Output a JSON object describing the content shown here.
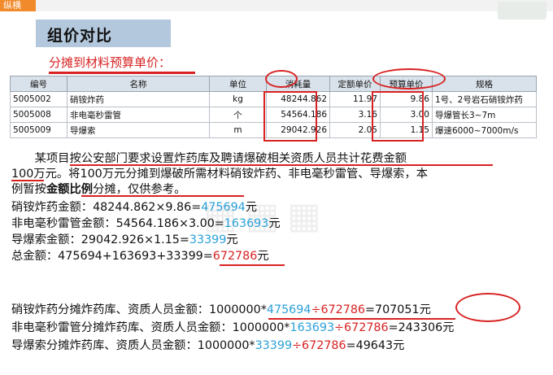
{
  "brand": {
    "label": "纵横"
  },
  "title": "组价对比",
  "subtitle": "分摊到材料预算单价：",
  "table": {
    "headers": [
      "编号",
      "名称",
      "单位",
      "消耗量",
      "定额单价",
      "预算单价",
      "规格"
    ],
    "rows": [
      [
        "5005002",
        "硝铵炸药",
        "kg",
        "48244.862",
        "11.97",
        "9.86",
        "1号、2号岩石硝铵炸药"
      ],
      [
        "5005008",
        "非电毫秒雷管",
        "个",
        "54564.186",
        "3.16",
        "3.00",
        "导爆管长3~7m"
      ],
      [
        "5005009",
        "导爆索",
        "m",
        "29042.926",
        "2.05",
        "1.15",
        "爆速6000~7000m/s"
      ]
    ]
  },
  "paragraph": {
    "line1": "某项目按公安部门要求设置炸药库及聘请爆破相关资质人员共计花费金额",
    "line2": "100万元。将100万元分摊到爆破所需材料硝铵炸药、非电毫秒雷管、导爆索，本",
    "line3_a": "例暂按",
    "line3_b": "金额比例",
    "line3_c": "分摊，仅供参考。"
  },
  "calc": [
    {
      "label": "硝铵炸药金额：48244.862×9.86=",
      "result": "475694",
      "unit": "元"
    },
    {
      "label": "非电毫秒雷管金额：54564.186×3.00=",
      "result": "163693",
      "unit": "元"
    },
    {
      "label": "导爆索金额：29042.926×1.15=",
      "result": "33399",
      "unit": "元"
    }
  ],
  "total": {
    "label": "总金额：475694+163693+33399=",
    "result": "672786",
    "unit": "元"
  },
  "alloc": [
    {
      "label": "硝铵炸药分摊炸药库、资质人员金额：1000000*",
      "num": "475694",
      "div": "÷",
      "den": "672786",
      "result": "=707051元"
    },
    {
      "label": "非电毫秒雷管分摊炸药库、资质人员金额：1000000*",
      "num": "163693",
      "div": "÷",
      "den": "672786",
      "result": "=243306元"
    },
    {
      "label": "导爆索分摊炸药库、资质人员金额：1000000*",
      "num": "33399",
      "div": "÷",
      "den": "672786",
      "result": "=49643元"
    }
  ],
  "colors": {
    "accent_red": "#d82222",
    "accent_blue": "#2aa0d8",
    "title_bar": "#b3c8dc",
    "brand": "#f08a2a"
  }
}
